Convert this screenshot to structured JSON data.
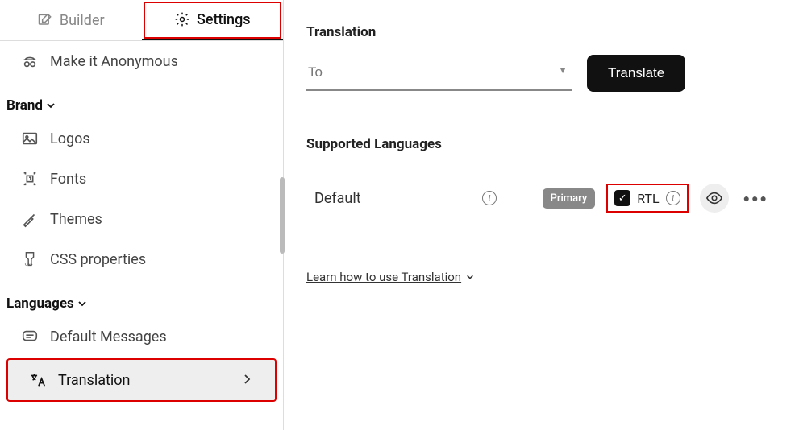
{
  "tabs": {
    "builder": "Builder",
    "settings": "Settings"
  },
  "sidebar": {
    "anon": "Make it Anonymous",
    "brand_h": "Brand",
    "logos": "Logos",
    "fonts": "Fonts",
    "themes": "Themes",
    "css": "CSS properties",
    "langs_h": "Languages",
    "defmsg": "Default Messages",
    "translation": "Translation"
  },
  "main": {
    "translation_h": "Translation",
    "to_placeholder": "To",
    "translate_btn": "Translate",
    "supported_h": "Supported Languages",
    "default_lang": "Default",
    "primary_badge": "Primary",
    "rtl_label": "RTL",
    "learn": "Learn how to use Translation"
  }
}
